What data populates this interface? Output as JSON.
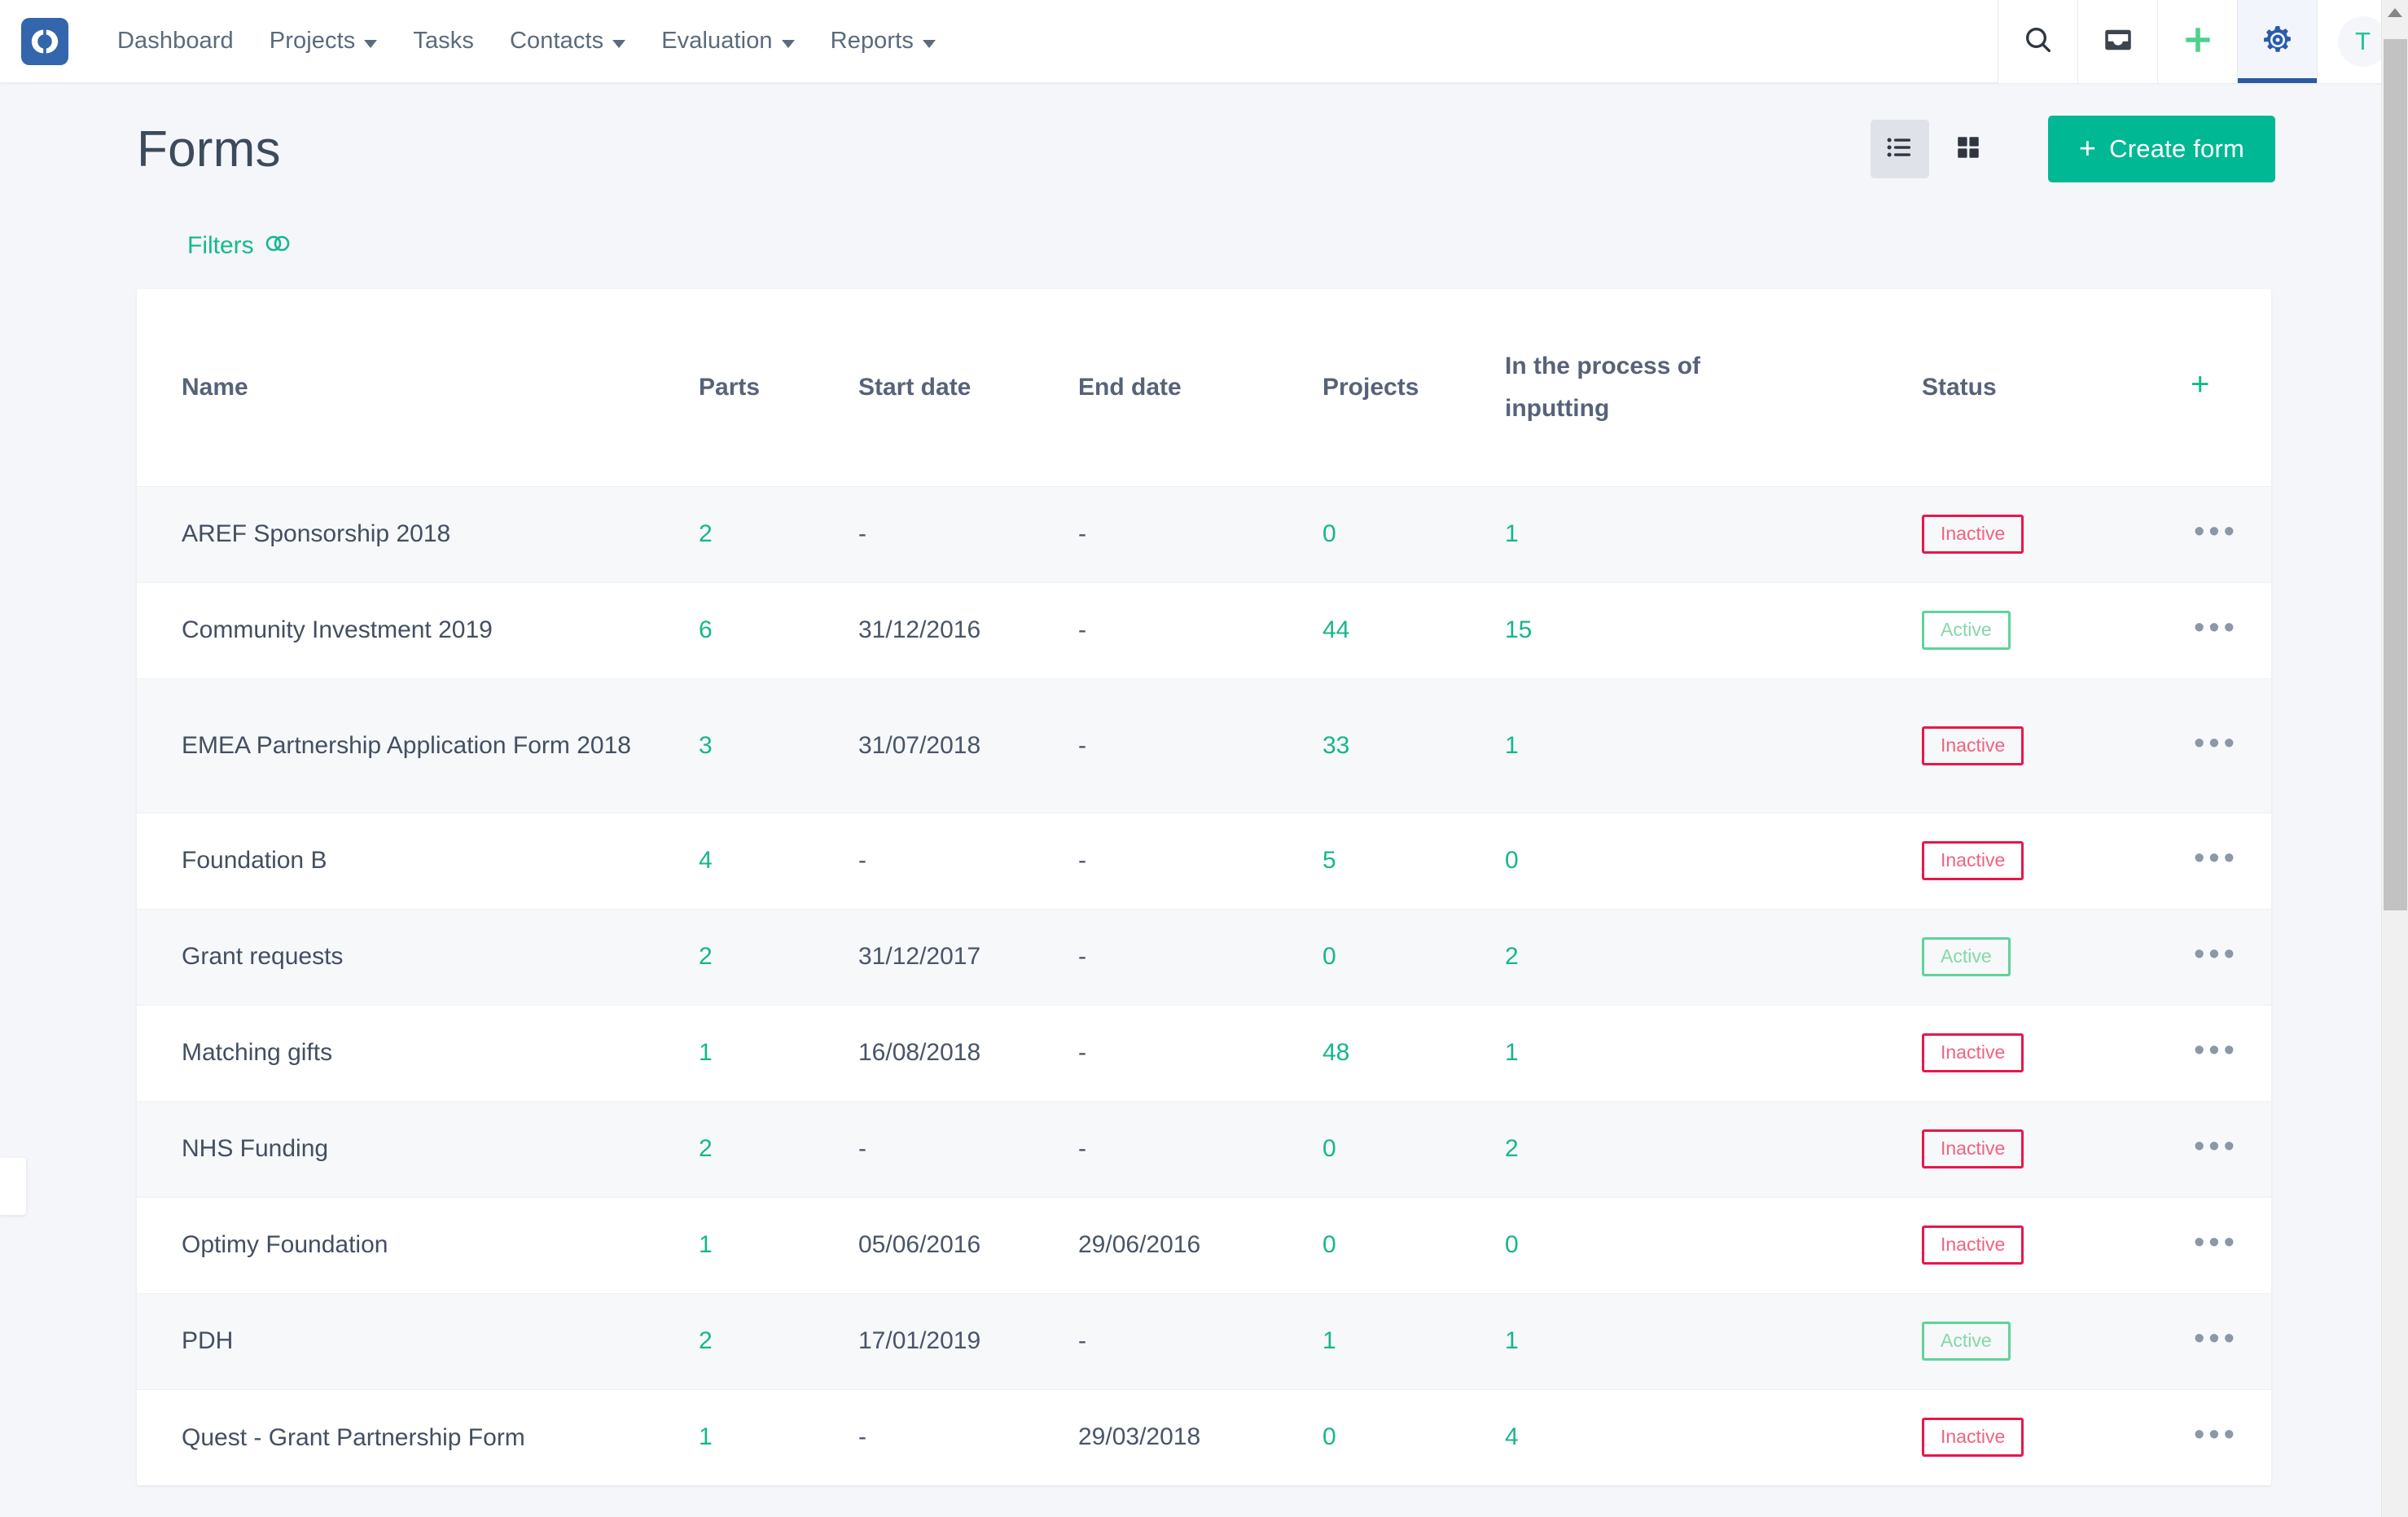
{
  "navbar": {
    "logo_icon": "optimy-split-circle-logo",
    "links": [
      {
        "label": "Dashboard",
        "has_dropdown": false
      },
      {
        "label": "Projects",
        "has_dropdown": true
      },
      {
        "label": "Tasks",
        "has_dropdown": false
      },
      {
        "label": "Contacts",
        "has_dropdown": true
      },
      {
        "label": "Evaluation",
        "has_dropdown": true
      },
      {
        "label": "Reports",
        "has_dropdown": true
      }
    ],
    "icons": [
      {
        "name": "search-icon",
        "active": false
      },
      {
        "name": "inbox-icon",
        "active": false
      },
      {
        "name": "plus-icon",
        "active": false
      },
      {
        "name": "gear-icon",
        "active": true
      }
    ],
    "avatar_initial": "T"
  },
  "header": {
    "title": "Forms",
    "view_list_icon": "list-view-icon",
    "view_grid_icon": "grid-view-icon",
    "active_view": "list",
    "create_button": "Create form",
    "create_button_icon": "plus-icon"
  },
  "filters": {
    "label": "Filters",
    "icon": "sliders-toggle-icon"
  },
  "table": {
    "columns": [
      "Name",
      "Parts",
      "Start date",
      "End date",
      "Projects",
      "In the process of inputting",
      "Status",
      "+"
    ],
    "add_column_icon": "plus-icon",
    "row_menu_icon": "ellipsis-horizontal-icon",
    "rows": [
      {
        "name": "AREF Sponsorship 2018",
        "parts": "2",
        "start_date": "-",
        "end_date": "-",
        "projects": "0",
        "in_process": "1",
        "status": "Inactive"
      },
      {
        "name": "Community Investment 2019",
        "parts": "6",
        "start_date": "31/12/2016",
        "end_date": "-",
        "projects": "44",
        "in_process": "15",
        "status": "Active"
      },
      {
        "name": "EMEA Partnership Application Form 2018",
        "parts": "3",
        "start_date": "31/07/2018",
        "end_date": "-",
        "projects": "33",
        "in_process": "1",
        "status": "Inactive"
      },
      {
        "name": "Foundation B",
        "parts": "4",
        "start_date": "-",
        "end_date": "-",
        "projects": "5",
        "in_process": "0",
        "status": "Inactive"
      },
      {
        "name": "Grant requests",
        "parts": "2",
        "start_date": "31/12/2017",
        "end_date": "-",
        "projects": "0",
        "in_process": "2",
        "status": "Active"
      },
      {
        "name": "Matching gifts",
        "parts": "1",
        "start_date": "16/08/2018",
        "end_date": "-",
        "projects": "48",
        "in_process": "1",
        "status": "Inactive"
      },
      {
        "name": "NHS Funding",
        "parts": "2",
        "start_date": "-",
        "end_date": "-",
        "projects": "0",
        "in_process": "2",
        "status": "Inactive"
      },
      {
        "name": "Optimy Foundation",
        "parts": "1",
        "start_date": "05/06/2016",
        "end_date": "29/06/2016",
        "projects": "0",
        "in_process": "0",
        "status": "Inactive"
      },
      {
        "name": "PDH",
        "parts": "2",
        "start_date": "17/01/2019",
        "end_date": "-",
        "projects": "1",
        "in_process": "1",
        "status": "Active"
      },
      {
        "name": "Quest - Grant Partnership Form",
        "parts": "1",
        "start_date": "-",
        "end_date": "29/03/2018",
        "projects": "0",
        "in_process": "4",
        "status": "Inactive"
      }
    ]
  },
  "colors": {
    "brand_blue": "#3366aa",
    "accent_green": "#00b894",
    "link_green": "#16b68c",
    "status_inactive": "#e8174a",
    "status_active": "#5fd39a",
    "page_bg": "#f4f6f9"
  }
}
